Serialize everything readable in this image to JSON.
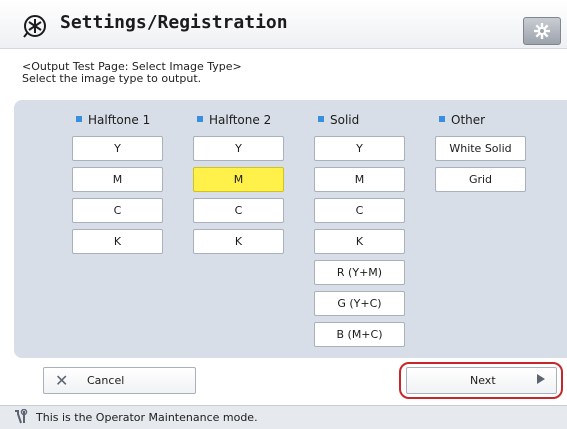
{
  "header": {
    "title": "Settings/Registration",
    "icon": "settings-registration-icon",
    "right_button_icon": "gear-icon"
  },
  "instructions": {
    "line1": "<Output Test Page: Select Image Type>",
    "line2": "Select the image type to output."
  },
  "columns": [
    {
      "header": "Halftone 1",
      "buttons": [
        "Y",
        "M",
        "C",
        "K"
      ]
    },
    {
      "header": "Halftone 2",
      "buttons": [
        "Y",
        "M",
        "C",
        "K"
      ]
    },
    {
      "header": "Solid",
      "buttons": [
        "Y",
        "M",
        "C",
        "K",
        "R (Y+M)",
        "G (Y+C)",
        "B (M+C)"
      ]
    },
    {
      "header": "Other",
      "buttons": [
        "White Solid",
        "Grid"
      ]
    }
  ],
  "selected": {
    "column": "Halftone 2",
    "button": "M"
  },
  "footer": {
    "cancel_label": "Cancel",
    "next_label": "Next"
  },
  "status": {
    "text": "This is the Operator Maintenance mode."
  },
  "colors": {
    "accent": "#3a8ee0",
    "selected": "#fff04a",
    "panel": "#d8dee7",
    "highlight": "#c7272a"
  }
}
